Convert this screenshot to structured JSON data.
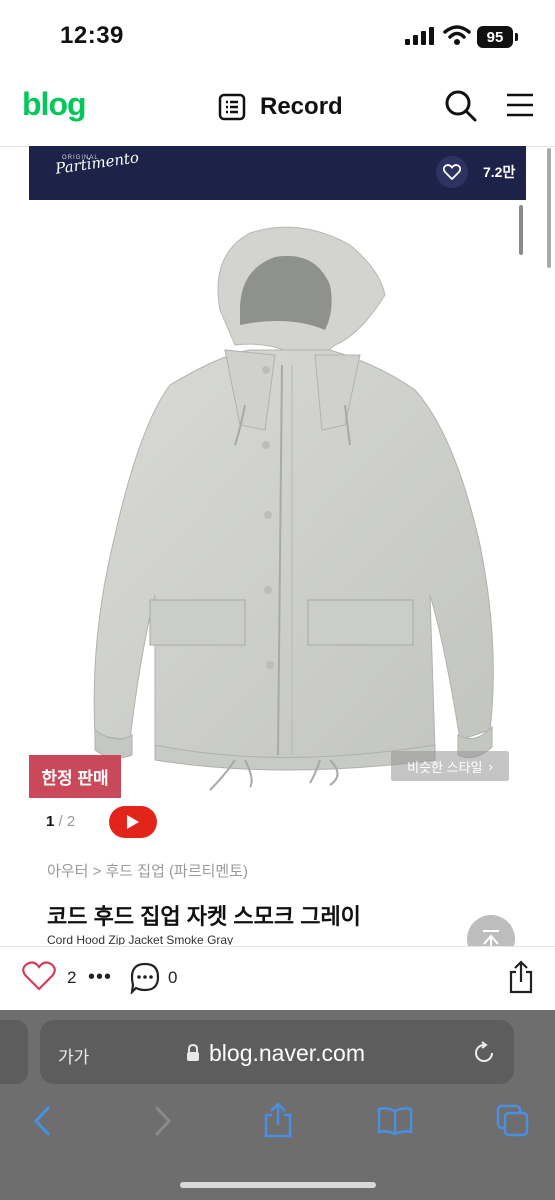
{
  "status_bar": {
    "time": "12:39",
    "battery": "95"
  },
  "header": {
    "logo": "blog",
    "title": "Record"
  },
  "banner": {
    "brand": "Partimento",
    "brand_sub": "ORIGINAL",
    "like_count": "7.2만"
  },
  "product": {
    "badge": "한정 판매",
    "similar_style": "비슷한 스타일",
    "page_current": "1",
    "page_total": "/ 2",
    "breadcrumb": "아우터 > 후드 집업 (파르티멘토)",
    "title": "코드 후드 집업 자켓 스모크 그레이",
    "subtitle": "Cord Hood Zip Jacket Smoke Gray"
  },
  "actions": {
    "like_count": "2",
    "more": "•••",
    "comment_count": "0"
  },
  "safari": {
    "aa": "가가",
    "url": "blog.naver.com"
  },
  "colors": {
    "brand_green": "#03c75a",
    "banner_navy": "#1d2348",
    "badge_red": "#c9495a",
    "youtube_red": "#e3241b"
  }
}
